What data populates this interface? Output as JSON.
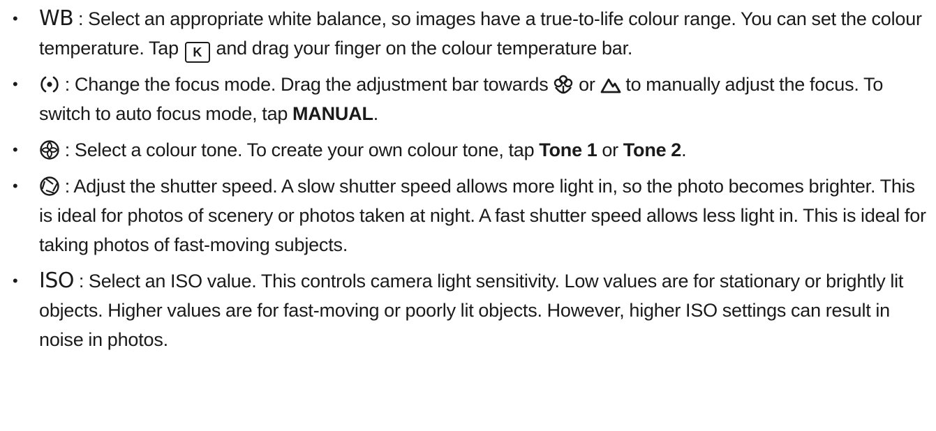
{
  "items": [
    {
      "icon_name": "wb-label",
      "label": "WB",
      "text_1": " : Select an appropriate white balance, so images have a true-to-life colour range. You can set the colour temperature. Tap ",
      "key_label": "K",
      "text_2": " and drag your finger on the colour temperature bar."
    },
    {
      "icon_name": "focus-icon",
      "text_1": " : Change the focus mode. Drag the adjustment bar towards ",
      "macro_icon_name": "macro-flower-icon",
      "text_2": " or ",
      "landscape_icon_name": "landscape-mountain-icon",
      "text_3": " to manually adjust the focus. To switch to auto focus mode, tap ",
      "bold_1": "MANUAL",
      "text_4": "."
    },
    {
      "icon_name": "colour-tone-icon",
      "text_1": " : Select a colour tone. To create your own colour tone, tap ",
      "bold_1": "Tone 1",
      "text_2": " or ",
      "bold_2": "Tone 2",
      "text_3": "."
    },
    {
      "icon_name": "shutter-speed-icon",
      "text_1": " : Adjust the shutter speed. A slow shutter speed allows more light in, so the photo becomes brighter. This is ideal for photos of scenery or photos taken at night. A fast shutter speed allows less light in. This is ideal for taking photos of fast-moving subjects."
    },
    {
      "icon_name": "iso-label",
      "label": "ISO",
      "text_1": " : Select an ISO value. This controls camera light sensitivity. Low values are for stationary or brightly lit objects. Higher values are for fast-moving or poorly lit objects. However, higher ISO settings can result in noise in photos."
    }
  ],
  "bullet": "•"
}
